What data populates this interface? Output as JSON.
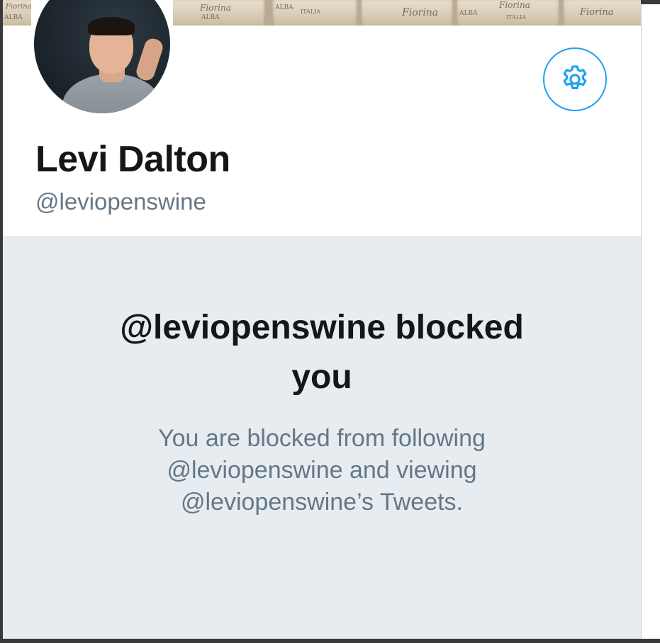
{
  "banner": {
    "label_texts": [
      "Fiorina",
      "ALBA",
      "ITALIA",
      "Fiorina",
      "ALBA",
      "ITALIA",
      "Fiorina",
      "ALBA",
      "ITALIA"
    ]
  },
  "profile": {
    "display_name": "Levi Dalton",
    "handle": "@leviopenswine",
    "avatar_icon": "profile-photo",
    "settings_icon": "gear-icon"
  },
  "blocked": {
    "title_line1": "@leviopenswine blocked",
    "title_line2": "you",
    "message_line1": "You are blocked from following",
    "message_line2": "@leviopenswine and viewing",
    "message_line3": "@leviopenswine’s Tweets."
  },
  "colors": {
    "accent": "#1da1f2",
    "panel_bg": "#e6ecf0",
    "secondary_text": "#657786",
    "primary_text": "#14171a"
  }
}
